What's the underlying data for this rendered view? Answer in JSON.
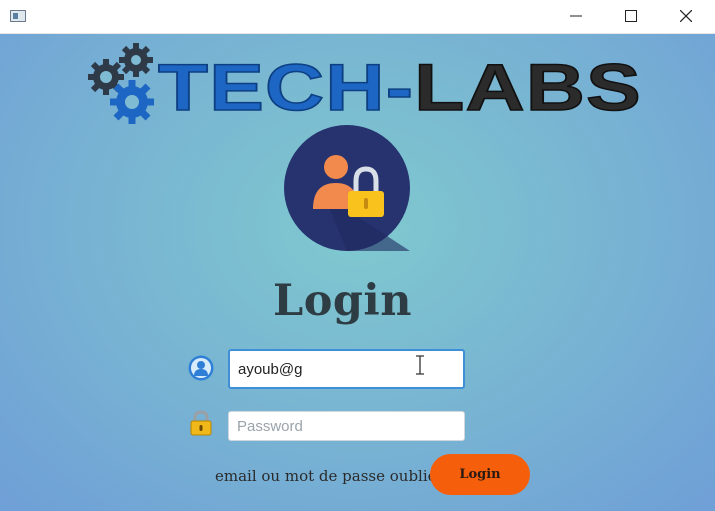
{
  "titlebar": {
    "app_icon": "window-app-icon",
    "controls": [
      "minimize-icon",
      "maximize-icon",
      "close-icon"
    ]
  },
  "logo": {
    "text": "TECH-LABS",
    "colors": {
      "tech": "#1d66c4",
      "labs": "#2b2b2b",
      "gear": "#2f3a48"
    }
  },
  "login": {
    "title": "Login",
    "email": {
      "value": "ayoub@g",
      "placeholder": "",
      "icon": "user-icon"
    },
    "password": {
      "value": "",
      "placeholder": "Password",
      "icon": "lock-icon"
    },
    "forgot_link": "email ou mot de passe oublié?",
    "login_button": "Login"
  },
  "colors": {
    "background": "#79b6d2",
    "accent": "#f55f0b",
    "focus": "#3f8fd8"
  }
}
